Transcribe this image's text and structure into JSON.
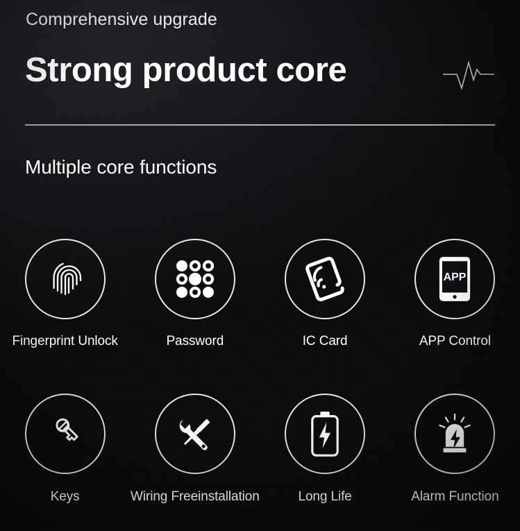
{
  "header": {
    "eyebrow": "Comprehensive upgrade",
    "headline": "Strong product core",
    "pulse_icon": "heartbeat-pulse-icon",
    "subheading": "Multiple core functions"
  },
  "theme": {
    "background": "#0d0d10",
    "foreground": "#ffffff",
    "divider": "#cfcfcf",
    "circle_stroke": "#e9e9e9"
  },
  "features": {
    "rows": [
      {
        "items": [
          {
            "label": "Fingerprint Unlock",
            "icon": "fingerprint-icon"
          },
          {
            "label": "Password",
            "icon": "keypad-dots-icon"
          },
          {
            "label": "IC Card",
            "icon": "ic-card-nfc-icon"
          },
          {
            "label": "APP Control",
            "icon": "smartphone-app-icon",
            "screen_text": "APP"
          }
        ]
      },
      {
        "items": [
          {
            "label": "Keys",
            "icon": "key-icon"
          },
          {
            "label": "Wiring Freeinstallation",
            "icon": "wrench-screwdriver-icon"
          },
          {
            "label": "Long Life",
            "icon": "battery-bolt-icon"
          },
          {
            "label": "Alarm Function",
            "icon": "alarm-siren-icon"
          }
        ]
      }
    ]
  }
}
